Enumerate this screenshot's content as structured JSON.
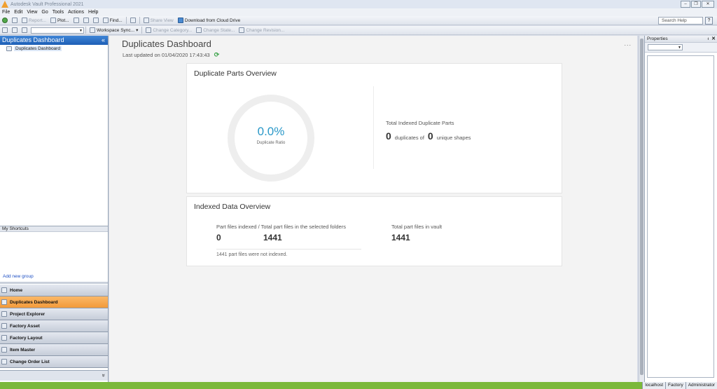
{
  "window": {
    "title": "Autodesk Vault Professional 2021"
  },
  "menu": [
    "File",
    "Edit",
    "View",
    "Go",
    "Tools",
    "Actions",
    "Help"
  ],
  "toolbar1": {
    "report": "Report...",
    "plot": "Plot...",
    "find": "Find...",
    "share_view": "Share View",
    "download_cloud": "Download from Cloud Drive",
    "search_help_placeholder": "Search Help",
    "help_label": "?"
  },
  "toolbar2": {
    "workspace_sync": "Workspace Sync...",
    "change_category": "Change Category...",
    "change_state": "Change State...",
    "change_revision": "Change Revision..."
  },
  "leftpane": {
    "header": "Duplicates Dashboard",
    "collapse": "«",
    "tree_item": "Duplicates Dashboard",
    "shortcuts": "My Shortcuts",
    "add_group": "Add new group",
    "nav": [
      "Home",
      "Duplicates Dashboard",
      "Project Explorer",
      "Factory Asset",
      "Factory Layout",
      "Item Master",
      "Change Order List"
    ],
    "active_nav": "Duplicates Dashboard"
  },
  "dashboard": {
    "title": "Duplicates Dashboard",
    "last_updated": "Last updated on 01/04/2020 17:43:43",
    "more": "...",
    "overview": {
      "title": "Duplicate Parts Overview",
      "ratio_value": "0.0%",
      "ratio_label": "Duplicate Ratio",
      "total_label": "Total Indexed Duplicate Parts",
      "duplicates_count": "0",
      "duplicates_of": "duplicates of",
      "unique_count": "0",
      "unique_shapes": "unique shapes"
    },
    "indexed": {
      "title": "Indexed Data Overview",
      "indexed_label": "Part files indexed / Total part files in the selected folders",
      "indexed_value": "0",
      "total_selected_value": "1441",
      "not_indexed_note": "1441 part files were not indexed.",
      "vault_label": "Total part files in vault",
      "vault_value": "1441"
    }
  },
  "properties": {
    "title": "Properties",
    "pin": "ᵻ",
    "close": "✕"
  },
  "statusbar": {
    "server": "localhost",
    "vault": "Factory",
    "user": "Administrator"
  },
  "colors": {
    "accent": "#2a98c8",
    "nav_active": "#f29a3a",
    "status_green": "#7bb83a",
    "header_blue": "#1d5fb6"
  }
}
